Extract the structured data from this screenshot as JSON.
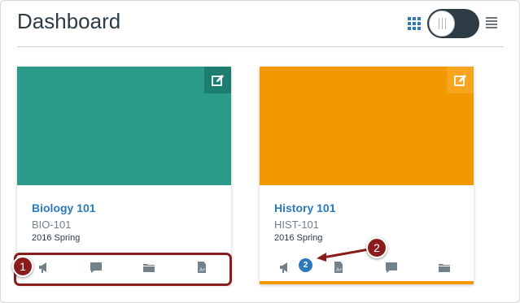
{
  "page": {
    "title": "Dashboard"
  },
  "view_toggle": {
    "grid_icon": "grid-icon",
    "list_icon": "list-icon"
  },
  "cards": [
    {
      "name": "Biology 101",
      "code": "BIO-101",
      "term": "2016 Spring",
      "color": "#2a9a8a"
    },
    {
      "name": "History 101",
      "code": "HIST-101",
      "term": "2016 Spring",
      "color": "#f29900",
      "announcement_badge": "2"
    }
  ],
  "card_actions": {
    "card_1": [
      "announcements-icon",
      "discussions-icon",
      "files-icon",
      "grades-icon"
    ],
    "card_2": [
      "announcements-icon",
      "grades-icon",
      "discussions-icon",
      "files-icon"
    ]
  },
  "callouts": [
    "1",
    "2"
  ],
  "colors": {
    "callout": "#8a1c1c",
    "link": "#2b7abc",
    "toggle": "#2d3b45"
  }
}
